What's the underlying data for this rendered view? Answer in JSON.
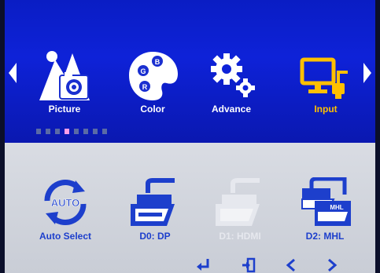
{
  "main_menu": {
    "items": [
      {
        "label": "Picture",
        "icon": "picture-icon",
        "active": false
      },
      {
        "label": "Color",
        "icon": "color-palette-icon",
        "active": false
      },
      {
        "label": "Advance",
        "icon": "gears-icon",
        "active": false
      },
      {
        "label": "Input",
        "icon": "input-monitor-icon",
        "active": true
      }
    ],
    "page_indicator": {
      "count": 8,
      "active_index": 3
    }
  },
  "input_menu": {
    "items": [
      {
        "label": "Auto Select",
        "icon": "auto-select-icon",
        "enabled": true
      },
      {
        "label": "D0: DP",
        "icon": "displayport-connector-icon",
        "enabled": true
      },
      {
        "label": "D1: HDMI",
        "icon": "hdmi-connector-icon",
        "enabled": false
      },
      {
        "label": "D2: MHL",
        "icon": "mhl-connector-icon",
        "enabled": true
      }
    ]
  },
  "controls": [
    {
      "icon": "enter-icon"
    },
    {
      "icon": "exit-icon"
    },
    {
      "icon": "chevron-left-icon"
    },
    {
      "icon": "chevron-right-icon"
    }
  ],
  "colors": {
    "header_blue": "#0e22d8",
    "active_label": "#ffc000",
    "sub_label": "#1d3fcc"
  }
}
